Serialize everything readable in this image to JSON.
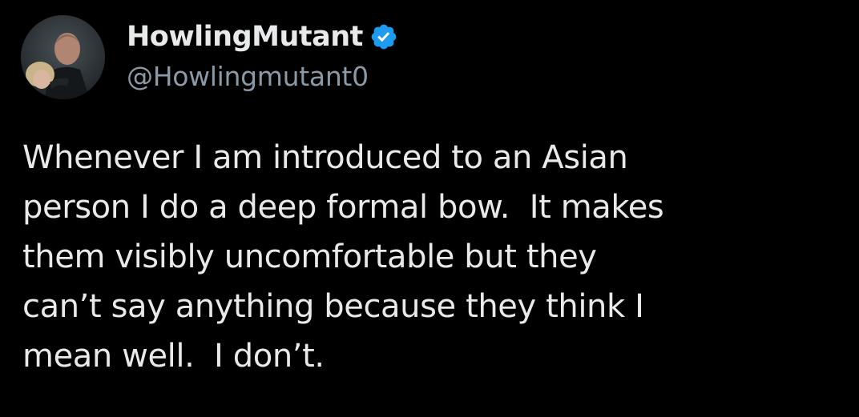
{
  "tweet": {
    "author": {
      "display_name": "HowlingMutant",
      "handle": "@Howlingmutant0",
      "verified": true,
      "avatar_icon": "profile-photo",
      "verified_icon": "verified-badge-icon",
      "verified_color": "#1d9bf0"
    },
    "text_lines": [
      "Whenever I am introduced to an Asian",
      "person I do a deep formal bow.  It makes",
      "them visibly uncomfortable but they",
      "can’t say anything because they think I",
      "mean well.  I don’t."
    ]
  },
  "colors": {
    "background": "#000000",
    "text_primary": "#e7e9ea",
    "text_secondary": "#8b98a5"
  }
}
